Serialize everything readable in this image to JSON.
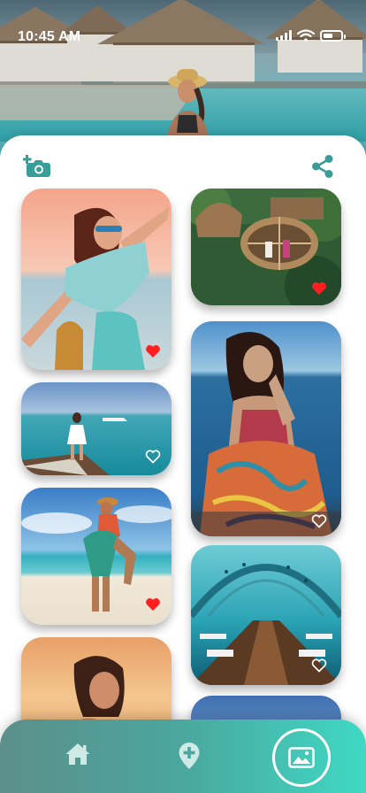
{
  "status_bar": {
    "time": "10:45 AM"
  },
  "toolbar": {
    "add_photo_icon": "camera-plus-icon",
    "share_icon": "share-icon"
  },
  "colors": {
    "accent": "#3a9e98",
    "heart_liked": "#ff1f1f",
    "heart_outline": "#ffffff",
    "nav_gradient_start": "#5c8f8a",
    "nav_gradient_end": "#3fd9c4"
  },
  "gallery": {
    "left_column": [
      {
        "photo": "woman-sunset-beach",
        "liked": true
      },
      {
        "photo": "woman-on-boat-deck",
        "liked": false
      },
      {
        "photo": "couple-beach-piggyback",
        "liked": true
      },
      {
        "photo": "woman-golden-hour",
        "liked": false
      }
    ],
    "right_column": [
      {
        "photo": "jungle-nest-swings",
        "liked": true
      },
      {
        "photo": "woman-sitting-by-sea",
        "liked": false
      },
      {
        "photo": "underwater-restaurant",
        "liked": false
      },
      {
        "photo": "sky-partial",
        "liked": false
      }
    ]
  },
  "bottom_nav": {
    "items": [
      {
        "icon": "home-icon",
        "active": false
      },
      {
        "icon": "add-location-icon",
        "active": false
      },
      {
        "icon": "gallery-icon",
        "active": true
      }
    ]
  }
}
